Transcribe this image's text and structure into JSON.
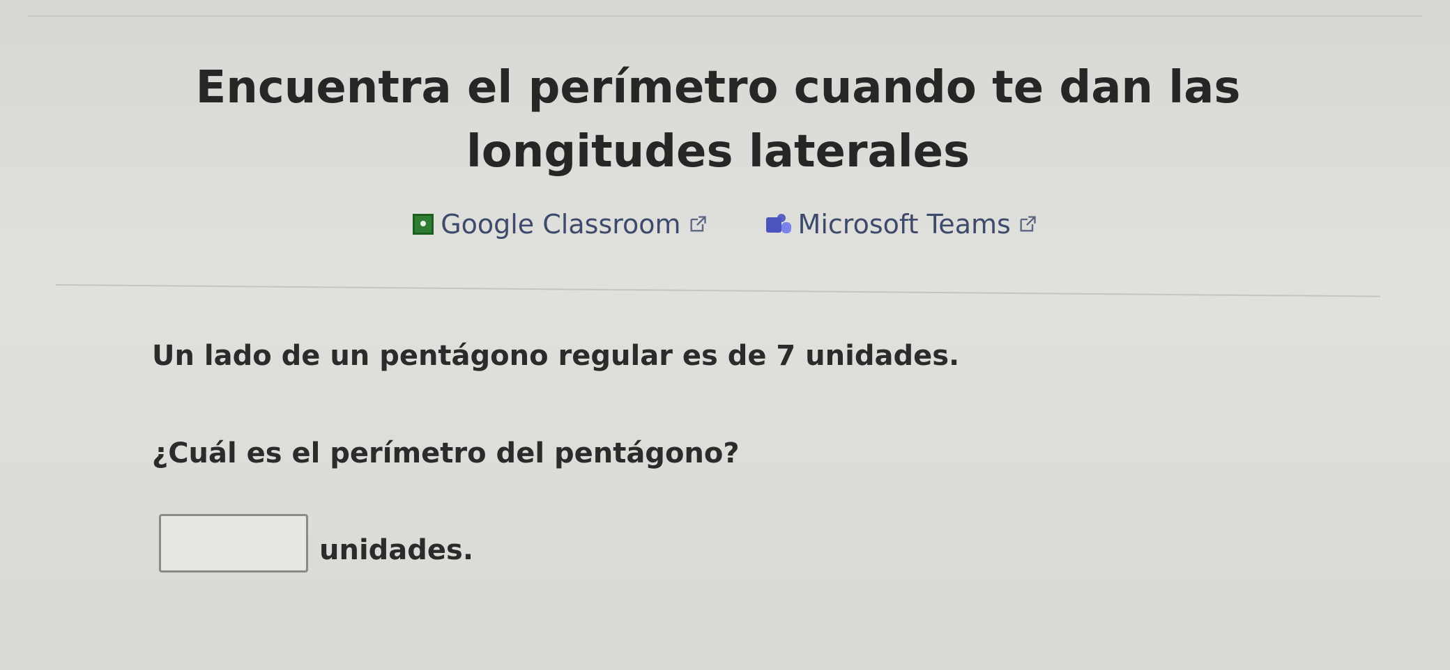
{
  "header": {
    "title": "Encuentra el perímetro cuando te dan las longitudes laterales"
  },
  "share": {
    "google_classroom": {
      "label": "Google Classroom",
      "icon": "google-classroom-icon"
    },
    "microsoft_teams": {
      "label": "Microsoft Teams",
      "icon": "microsoft-teams-icon"
    }
  },
  "problem": {
    "statement": "Un lado de un pentágono regular es de 7 unidades.",
    "question": "¿Cuál es el perímetro del pentágono?",
    "answer": {
      "value": "",
      "unit": "unidades."
    }
  },
  "colors": {
    "background": "#dcdcd8",
    "text": "#262626",
    "link": "#3d4a6b",
    "google_classroom": "#2e7d32",
    "teams": "#4b53bc"
  }
}
